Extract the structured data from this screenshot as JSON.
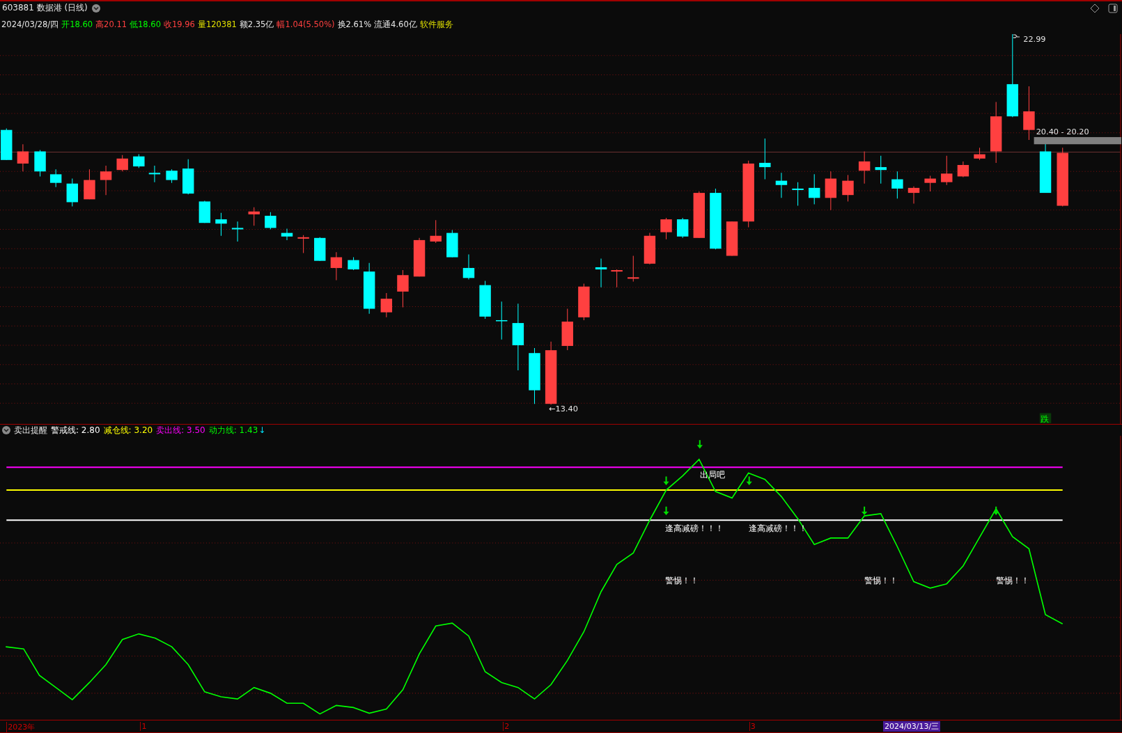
{
  "title_bar": {
    "code": "603881",
    "name": "数据港",
    "period": "(日线)"
  },
  "quote": {
    "date": "2024/03/28/四",
    "items": [
      {
        "label": "开",
        "value": "18.60",
        "color": "#00ff00"
      },
      {
        "label": "高",
        "value": "20.11",
        "color": "#ff4040"
      },
      {
        "label": "低",
        "value": "18.60",
        "color": "#00ff00"
      },
      {
        "label": "收",
        "value": "19.96",
        "color": "#ff4040"
      },
      {
        "label": "量",
        "value": "120381",
        "color": "#e0e000"
      },
      {
        "label": "额",
        "value": "2.35亿",
        "color": "#e6e6e6"
      },
      {
        "label": "幅",
        "value": "1.04(5.50%)",
        "color": "#ff4040"
      },
      {
        "label": "换",
        "value": "2.61%",
        "color": "#e6e6e6"
      },
      {
        "label": "流通",
        "value": "4.60亿",
        "color": "#e6e6e6"
      }
    ],
    "sector": "软件服务"
  },
  "main_chart": {
    "high_label": "22.99",
    "low_label": "←13.40",
    "range_label": "20.40 - 20.20",
    "signal_badge": "跌"
  },
  "indicator": {
    "name": "卖出提醒",
    "lines": [
      {
        "label": "警戒线:",
        "value": "2.80",
        "color": "#ffffff"
      },
      {
        "label": "减仓线:",
        "value": "3.20",
        "color": "#ffff00"
      },
      {
        "label": "卖出线:",
        "value": "3.50",
        "color": "#ff00ff"
      },
      {
        "label": "动力线:",
        "value": "1.43",
        "color": "#00ff00"
      }
    ],
    "trend_mark": "↓",
    "annotations": [
      {
        "text": "出局吧"
      },
      {
        "text": "逢高减磅！！！"
      },
      {
        "text": "逢高减磅！！！"
      },
      {
        "text": "警惕！！"
      },
      {
        "text": "警惕！！"
      },
      {
        "text": "警惕！！"
      }
    ]
  },
  "time_axis": {
    "labels": [
      "2023年",
      "1",
      "2",
      "3"
    ],
    "cursor_date": "2024/03/13/三"
  }
}
